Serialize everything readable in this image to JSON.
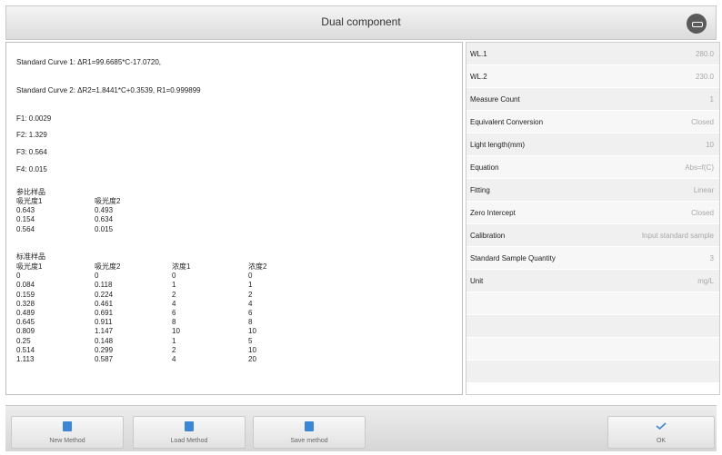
{
  "window": {
    "title": "Dual component"
  },
  "result": {
    "curve1": "Standard Curve 1: ΔR1=99.6685*C-17.0720,",
    "curve2": "Standard Curve 2: ΔR2=1.8441*C+0.3539, R1=0.999899",
    "f1": "F1: 0.0029",
    "f2": "F2: 1.329",
    "f3": "F3: 0.564",
    "f4": "F4: 0.015",
    "ref_title": "参比样品",
    "ref_col1": "吸光度1\n0.643\n0.154\n0.564",
    "ref_col2": "吸光度2\n0.493\n0.634\n0.015",
    "std_title": "标准样品",
    "std_col1": "吸光度1\n0\n0.084\n0.159\n0.328\n0.489\n0.645\n0.809\n0.25\n0.514\n1.113",
    "std_col2": "吸光度2\n0\n0.118\n0.224\n0.461\n0.691\n0.911\n1.147\n0.148\n0.299\n0.587",
    "std_col3": "浓度1\n0\n1\n2\n4\n6\n8\n10\n1\n2\n4",
    "std_col4": "浓度2\n0\n1\n2\n4\n6\n8\n10\n5\n10\n20"
  },
  "params": [
    {
      "label": "WL.1",
      "value": "280.0"
    },
    {
      "label": "WL.2",
      "value": "230.0"
    },
    {
      "label": "Measure Count",
      "value": "1"
    },
    {
      "label": "Equivalent Conversion",
      "value": "Closed"
    },
    {
      "label": "Light length(mm)",
      "value": "10"
    },
    {
      "label": "Equation",
      "value": "Abs=f(C)"
    },
    {
      "label": "Fitting",
      "value": "Linear"
    },
    {
      "label": "Zero Intercept",
      "value": "Closed"
    },
    {
      "label": "Calibration",
      "value": "Input standard sample"
    },
    {
      "label": "Standard Sample Quantity",
      "value": "3"
    },
    {
      "label": "Unit",
      "value": "mg/L"
    }
  ],
  "toolbar": {
    "new_method": "New Method",
    "load_method": "Load Method",
    "save_method": "Save method",
    "ok": "OK"
  },
  "colors": {
    "accent_blue": "#3a86d8"
  },
  "icons": {
    "back": "back-icon",
    "method": "document-icon",
    "ok": "check-icon"
  }
}
